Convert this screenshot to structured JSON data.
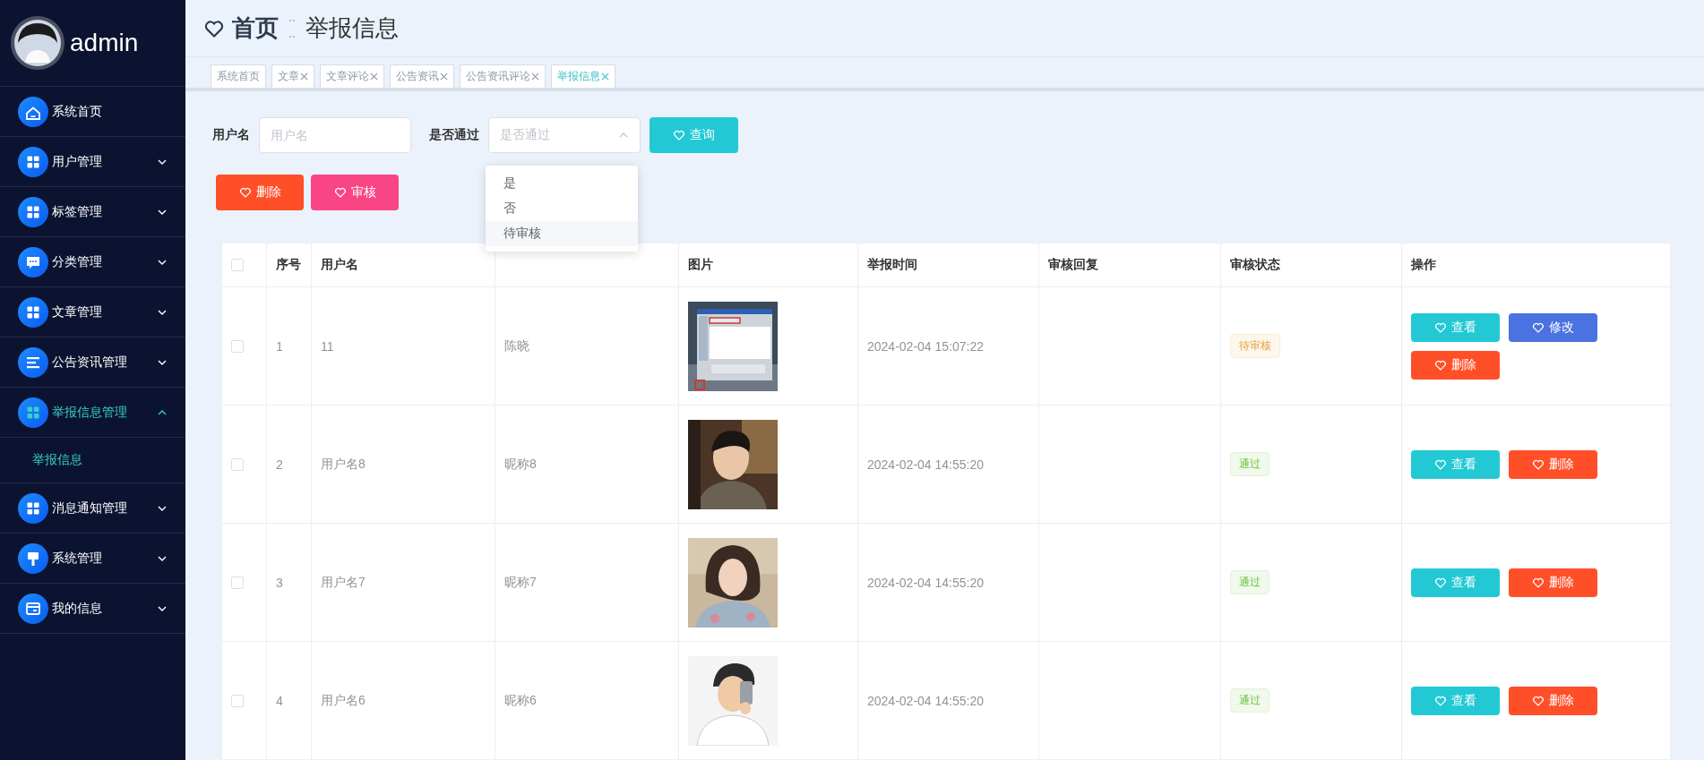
{
  "sidebar": {
    "user": "admin",
    "items": [
      {
        "label": "系统首页",
        "expandable": false,
        "selected": false
      },
      {
        "label": "用户管理",
        "expandable": true,
        "expanded": false,
        "selected": false
      },
      {
        "label": "标签管理",
        "expandable": true,
        "expanded": false,
        "selected": false
      },
      {
        "label": "分类管理",
        "expandable": true,
        "expanded": false,
        "selected": false
      },
      {
        "label": "文章管理",
        "expandable": true,
        "expanded": false,
        "selected": false
      },
      {
        "label": "公告资讯管理",
        "expandable": true,
        "expanded": false,
        "selected": false
      },
      {
        "label": "举报信息管理",
        "expandable": true,
        "expanded": true,
        "selected": true,
        "children": [
          {
            "label": "举报信息",
            "selected": true
          }
        ]
      },
      {
        "label": "消息通知管理",
        "expandable": true,
        "expanded": false,
        "selected": false
      },
      {
        "label": "系统管理",
        "expandable": true,
        "expanded": false,
        "selected": false
      },
      {
        "label": "我的信息",
        "expandable": true,
        "expanded": false,
        "selected": false
      }
    ]
  },
  "breadcrumb": {
    "home": "首页",
    "current": "举报信息"
  },
  "tabs": [
    {
      "label": "系统首页",
      "closable": false,
      "selected": false
    },
    {
      "label": "文章",
      "closable": true,
      "selected": false
    },
    {
      "label": "文章评论",
      "closable": true,
      "selected": false
    },
    {
      "label": "公告资讯",
      "closable": true,
      "selected": false
    },
    {
      "label": "公告资讯评论",
      "closable": true,
      "selected": false
    },
    {
      "label": "举报信息",
      "closable": true,
      "selected": true
    }
  ],
  "filters": {
    "username_label": "用户名",
    "username_placeholder": "用户名",
    "passed_label": "是否通过",
    "passed_placeholder": "是否通过",
    "passed_open": true,
    "options": [
      {
        "label": "是",
        "hovered": false
      },
      {
        "label": "否",
        "hovered": false
      },
      {
        "label": "待审核",
        "hovered": true
      }
    ],
    "search_button": "查询"
  },
  "toolbar": [
    {
      "label": "删除",
      "kind": "delete"
    },
    {
      "label": "审核",
      "kind": "review"
    }
  ],
  "table": {
    "select_all": {
      "checked": false
    },
    "columns": [
      {
        "kind": "text",
        "label": "序号"
      },
      {
        "kind": "text",
        "label": "用户名"
      },
      {
        "kind": "blank"
      },
      {
        "kind": "text",
        "label": "图片"
      },
      {
        "kind": "text",
        "label": "举报时间"
      },
      {
        "kind": "text",
        "label": "审核回复"
      },
      {
        "kind": "text",
        "label": "审核状态"
      },
      {
        "kind": "text",
        "label": "操作"
      }
    ],
    "rows": [
      {
        "checked": false,
        "index": "1",
        "username": "11",
        "nickname": "陈晓",
        "picture": {
          "kind": "picture"
        },
        "time": "2024-02-04 15:07:22",
        "status": {
          "label": "待审核",
          "kind": "pending"
        },
        "actions": [
          {
            "label": "查看",
            "kind": "view"
          },
          {
            "label": "修改",
            "kind": "edit"
          },
          {
            "label": "删除",
            "kind": "delete"
          }
        ]
      },
      {
        "checked": false,
        "index": "2",
        "username": "用户名8",
        "nickname": "昵称8",
        "picture": {
          "kind": "picture"
        },
        "time": "2024-02-04 14:55:20",
        "status": {
          "label": "通过",
          "kind": "passed"
        },
        "actions": [
          {
            "label": "查看",
            "kind": "view"
          },
          {
            "label": "删除",
            "kind": "delete"
          }
        ]
      },
      {
        "checked": false,
        "index": "3",
        "username": "用户名7",
        "nickname": "昵称7",
        "picture": {
          "kind": "picture"
        },
        "time": "2024-02-04 14:55:20",
        "status": {
          "label": "通过",
          "kind": "passed"
        },
        "actions": [
          {
            "label": "查看",
            "kind": "view"
          },
          {
            "label": "删除",
            "kind": "delete"
          }
        ]
      },
      {
        "checked": false,
        "index": "4",
        "username": "用户名6",
        "nickname": "昵称6",
        "picture": {
          "kind": "picture"
        },
        "time": "2024-02-04 14:55:20",
        "status": {
          "label": "通过",
          "kind": "passed"
        },
        "actions": [
          {
            "label": "查看",
            "kind": "view"
          },
          {
            "label": "删除",
            "kind": "delete"
          }
        ]
      }
    ]
  }
}
